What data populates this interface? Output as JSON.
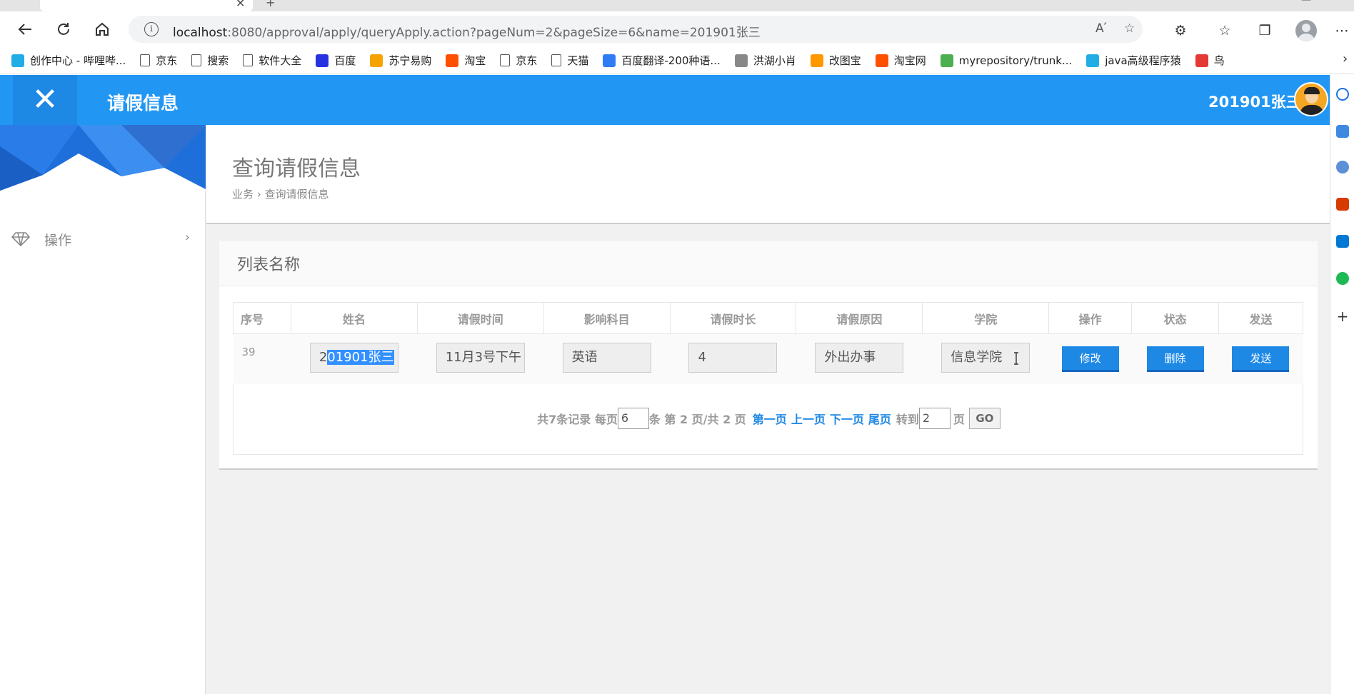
{
  "browser": {
    "url_host": "localhost",
    "url_rest": ":8080/approval/apply/queryApply.action?pageNum=2&pageSize=6&name=201901张三",
    "bookmarks": [
      {
        "label": "创作中心 - 哔哩哔...",
        "icon": "bilibili-icon",
        "color": "#23ade5"
      },
      {
        "label": "京东",
        "icon": "page-icon",
        "color": ""
      },
      {
        "label": "搜索",
        "icon": "page-icon",
        "color": ""
      },
      {
        "label": "软件大全",
        "icon": "page-icon",
        "color": ""
      },
      {
        "label": "百度",
        "icon": "baidu-icon",
        "color": "#2932e1"
      },
      {
        "label": "苏宁易购",
        "icon": "suning-icon",
        "color": "#f5a300"
      },
      {
        "label": "淘宝",
        "icon": "taobao-icon",
        "color": "#ff5000"
      },
      {
        "label": "京东",
        "icon": "page-icon",
        "color": ""
      },
      {
        "label": "天猫",
        "icon": "page-icon",
        "color": ""
      },
      {
        "label": "百度翻译-200种语...",
        "icon": "translate-icon",
        "color": "#2f7df6"
      },
      {
        "label": "洪湖小肖",
        "icon": "bird-icon",
        "color": "#888888"
      },
      {
        "label": "改图宝",
        "icon": "gaitubao-icon",
        "color": "#ff9800"
      },
      {
        "label": "淘宝网",
        "icon": "taobao-icon",
        "color": "#ff5000"
      },
      {
        "label": "myrepository/trunk...",
        "icon": "chrome-icon",
        "color": "#4caf50"
      },
      {
        "label": "java高级程序猿",
        "icon": "bilibili-icon",
        "color": "#23ade5"
      },
      {
        "label": "鸟",
        "icon": "bird-red-icon",
        "color": "#e53935"
      }
    ]
  },
  "header": {
    "title": "请假信息",
    "user": "201901张三"
  },
  "sidebar": {
    "items": [
      {
        "label": "操作"
      }
    ]
  },
  "page": {
    "title": "查询请假信息",
    "breadcrumb": "业务 › 查询请假信息",
    "panel_title": "列表名称"
  },
  "table": {
    "columns": [
      "序号",
      "姓名",
      "请假时间",
      "影响科目",
      "请假时长",
      "请假原因",
      "学院",
      "操作",
      "状态",
      "发送"
    ],
    "rows": [
      {
        "index": "39",
        "name_pre": "2",
        "name_selected": "01901张三",
        "time": "11月3号下午",
        "subject": "英语",
        "duration": "4",
        "reason": "外出办事",
        "college": "信息学院",
        "edit_label": "修改",
        "delete_label": "删除",
        "send_label": "发送"
      }
    ]
  },
  "pager": {
    "total_text": "共7条记录 每页",
    "page_size": "6",
    "mid_text": "条 第 2 页/共 2 页",
    "first": "第一页",
    "prev": "上一页",
    "next": "下一页",
    "last": "尾页",
    "goto_text": "转到",
    "goto_value": "2",
    "page_unit": "页",
    "go_label": "GO"
  },
  "colors": {
    "topbar": "#2196f3",
    "button": "#1e88e5",
    "selection": "#3390ff"
  }
}
